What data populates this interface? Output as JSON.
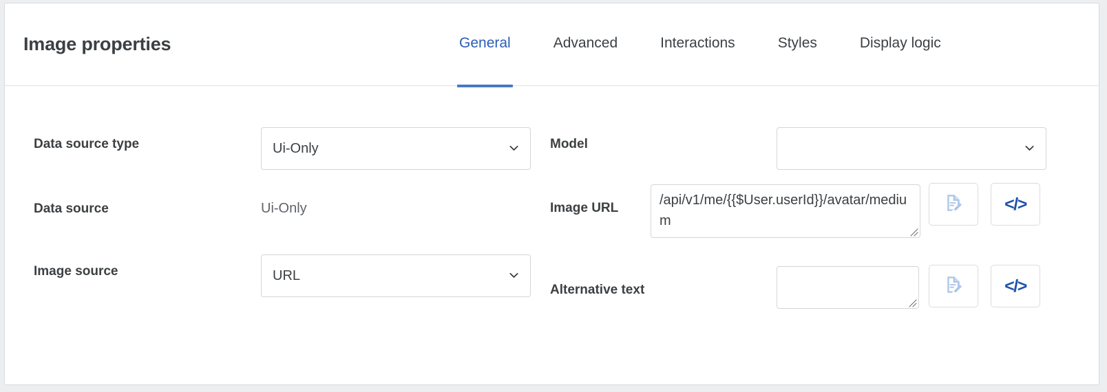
{
  "header": {
    "title": "Image properties",
    "tabs": [
      {
        "label": "General",
        "active": true
      },
      {
        "label": "Advanced",
        "active": false
      },
      {
        "label": "Interactions",
        "active": false
      },
      {
        "label": "Styles",
        "active": false
      },
      {
        "label": "Display logic",
        "active": false
      }
    ]
  },
  "form": {
    "left": {
      "data_source_type": {
        "label": "Data source type",
        "value": "Ui-Only",
        "control": "select"
      },
      "data_source": {
        "label": "Data source",
        "value": "Ui-Only",
        "control": "static-text"
      },
      "image_source": {
        "label": "Image source",
        "value": "URL",
        "control": "select"
      }
    },
    "right": {
      "model": {
        "label": "Model",
        "value": "",
        "control": "select"
      },
      "image_url": {
        "label": "Image URL",
        "value": "/api/v1/me/{{$User.userId}}/avatar/medium",
        "placeholder": "",
        "control": "textarea"
      },
      "alternative_text": {
        "label": "Alternative text",
        "value": "",
        "placeholder": "",
        "control": "textarea"
      }
    }
  },
  "icons": {
    "document_edit": "document-edit-icon",
    "code": "code-icon",
    "chevron": "chevron-down-icon",
    "resize": "resize-grip-icon"
  },
  "colors": {
    "accent_tab_text": "#2b5cb8",
    "accent_tab_underline": "#4779c4",
    "code_icon": "#1f52ac",
    "document_icon": "#aec6e8",
    "label_text": "#3c4043",
    "border": "#d2d6da"
  }
}
